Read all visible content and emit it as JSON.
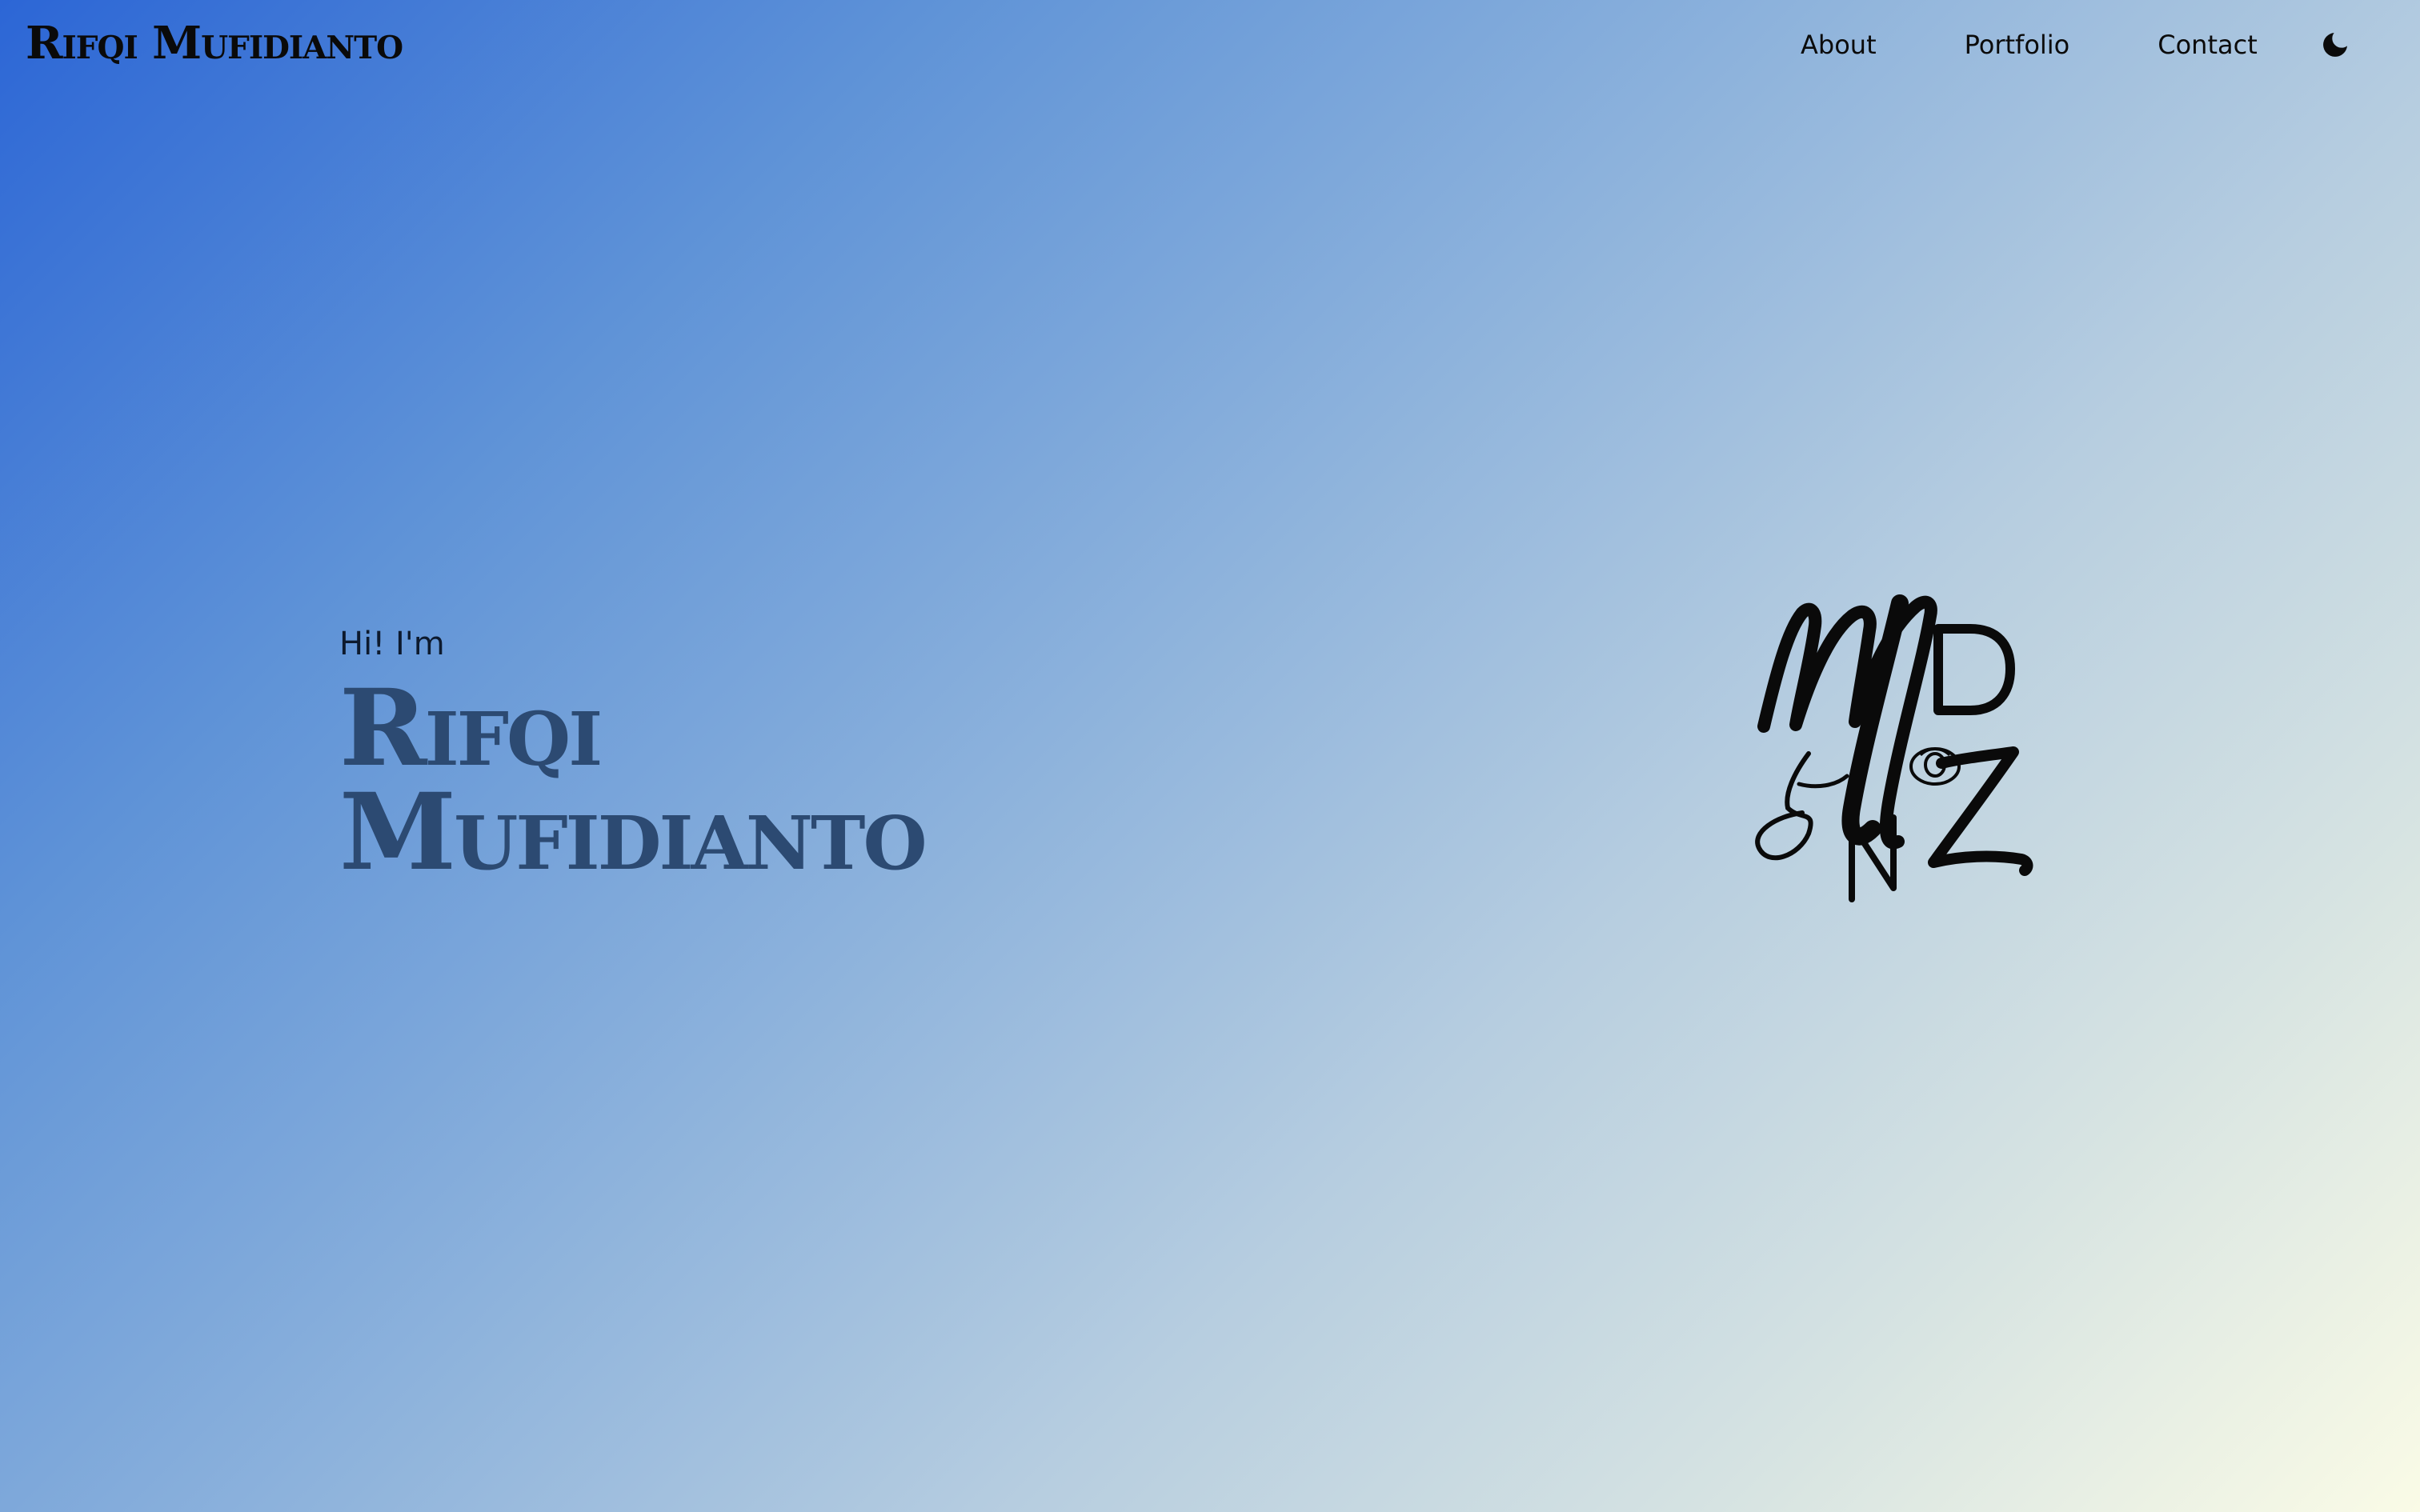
{
  "header": {
    "brand": "Rifqi Mufidianto",
    "nav": [
      {
        "label": "About"
      },
      {
        "label": "Portfolio"
      },
      {
        "label": "Contact"
      }
    ],
    "theme_toggle_icon": "moon-icon"
  },
  "hero": {
    "greeting": "Hi! I'm",
    "name_line1": "Rifqi",
    "name_line2": "Mufidianto"
  },
  "logo": {
    "icon": "monogram-logo",
    "letters": "MDZN"
  },
  "colors": {
    "gradient_start": "#2c66d6",
    "gradient_end": "#fafbe6",
    "hero_name": "#2c4a72",
    "text": "#0b0b0b"
  }
}
